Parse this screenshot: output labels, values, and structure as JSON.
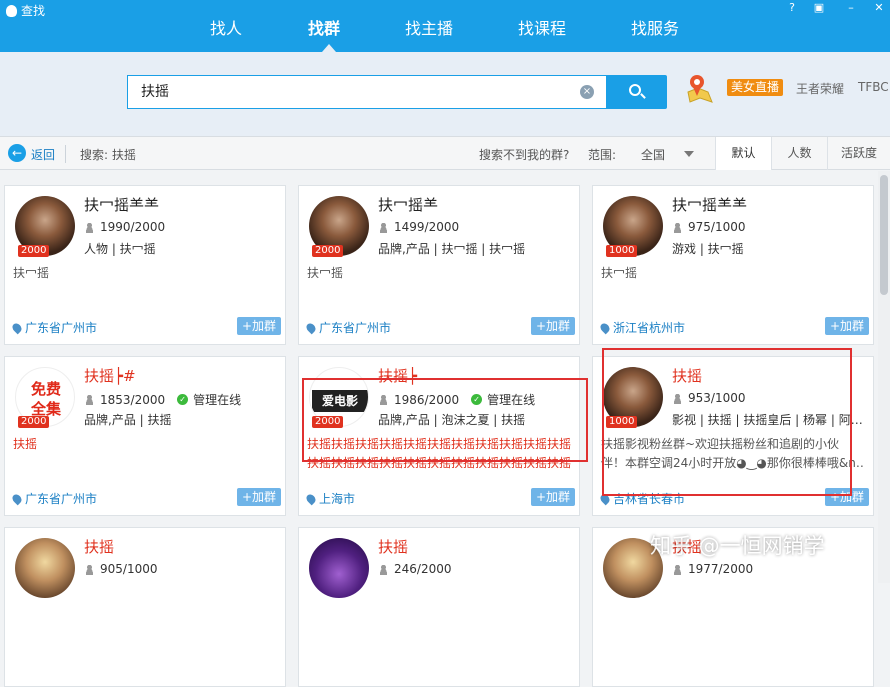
{
  "app": {
    "title": "查找"
  },
  "window_controls": [
    "?",
    "▣",
    "–",
    "✕"
  ],
  "nav": {
    "tabs": [
      "找人",
      "找群",
      "找主播",
      "找课程",
      "找服务"
    ],
    "active": "找群"
  },
  "search": {
    "value": "扶摇",
    "clear_icon": "×"
  },
  "promo": {
    "badge": "美女直播",
    "hot_words": [
      "王者荣耀",
      "TFBC"
    ]
  },
  "filter": {
    "back": "返回",
    "query_label": "搜索: 扶摇",
    "not_found": "搜索不到我的群?",
    "scope_label": "范围:",
    "scope_value": "全国",
    "sort_tabs": [
      "默认",
      "人数",
      "活跃度"
    ],
    "sort_active": "默认"
  },
  "cards": [
    {
      "name": "扶冖摇⺷⺷",
      "badge": "2000",
      "members": "1990/2000",
      "admin": "",
      "tags": "人物 | 扶冖摇",
      "desc": "扶冖摇",
      "desc2": "",
      "location": "广东省广州市",
      "join": "+加群"
    },
    {
      "name": "扶冖摇⺷",
      "badge": "2000",
      "members": "1499/2000",
      "admin": "",
      "tags": "品牌,产品 | 扶冖摇 | 扶冖摇",
      "desc": "扶冖摇",
      "desc2": "",
      "location": "广东省广州市",
      "join": "+加群"
    },
    {
      "name": "扶冖摇⺷⺷",
      "badge": "1000",
      "members": "975/1000",
      "admin": "",
      "tags": "游戏 | 扶冖摇",
      "desc": "扶冖摇",
      "desc2": "",
      "location": "浙江省杭州市",
      "join": "+加群"
    },
    {
      "name": "扶摇┝#",
      "badge": "2000",
      "members": "1853/2000",
      "admin": "管理在线",
      "tags": "品牌,产品 | 扶摇",
      "desc": "扶摇",
      "desc2": "",
      "location": "广东省广州市",
      "join": "+加群",
      "avatar_text": [
        "免费",
        "全集"
      ]
    },
    {
      "name": "扶摇┝",
      "badge": "2000",
      "members": "1986/2000",
      "admin": "管理在线",
      "tags": "品牌,产品 | 泡沫之夏 | 扶摇",
      "desc": "扶摇扶摇扶摇扶摇扶摇扶摇扶摇扶摇扶摇扶摇扶摇",
      "desc2": "扶摇扶摇扶摇扶摇扶摇扶摇扶摇扶摇扶摇扶摇扶摇",
      "location": "上海市",
      "join": "+加群",
      "avatar_text": [
        "爱电影"
      ]
    },
    {
      "name": "扶摇",
      "badge": "1000",
      "members": "953/1000",
      "admin": "",
      "tags": "影视 | 扶摇 | 扶摇皇后 | 杨幂 | 阿…",
      "desc": "扶摇影视粉丝群~欢迎扶摇粉丝和追剧的小伙",
      "desc2": "伴！本群空调24小时开放◕‿◕那你很棒棒哦&n…",
      "location": "吉林省长春市",
      "join": "+加群"
    },
    {
      "name": "扶摇",
      "badge": "",
      "members": "905/1000",
      "admin": "",
      "tags": "",
      "desc": "",
      "desc2": "",
      "location": "",
      "join": ""
    },
    {
      "name": "扶摇",
      "badge": "",
      "members": "246/2000",
      "admin": "",
      "tags": "",
      "desc": "",
      "desc2": "",
      "location": "",
      "join": ""
    },
    {
      "name": "扶摇",
      "badge": "",
      "members": "1977/2000",
      "admin": "",
      "tags": "",
      "desc": "",
      "desc2": "",
      "location": "",
      "join": ""
    }
  ],
  "watermark": "知乎 @一恒网销学",
  "colors": {
    "header": "#1a9fe6",
    "accent": "#e0321f",
    "link": "#1a7fc4",
    "join": "#6fb4e8"
  }
}
